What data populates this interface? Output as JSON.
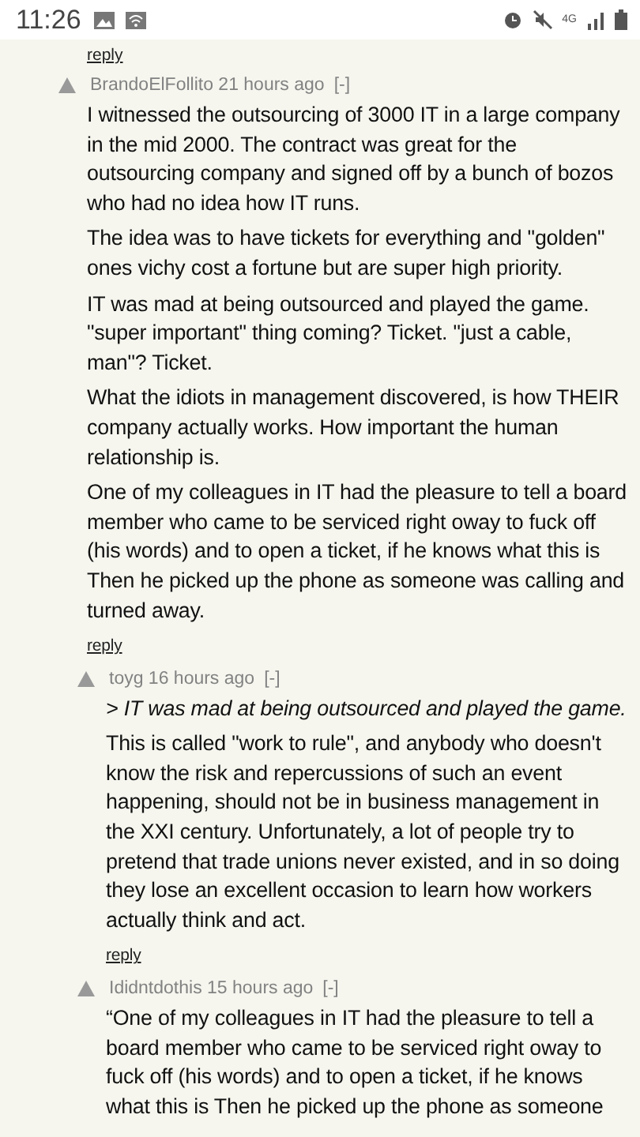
{
  "status_bar": {
    "time": "11:26",
    "network": "4G"
  },
  "top_reply": "reply",
  "comments": [
    {
      "author": "BrandoElFollito",
      "age": "21 hours ago",
      "toggle": "[-]",
      "reply": "reply",
      "paragraphs": [
        {
          "kind": "text",
          "text": "I witnessed the outsourcing of 3000 IT in a large company in the mid 2000. The contract was great for the outsourcing company and signed off by a bunch of bozos who had no idea how IT runs."
        },
        {
          "kind": "text",
          "text": "The idea was to have tickets for everything and \"golden\" ones vichy cost a fortune but are super high priority."
        },
        {
          "kind": "text",
          "text": "IT was mad at being outsourced and played the game. \"super important\" thing coming? Ticket. \"just a cable, man\"? Ticket."
        },
        {
          "kind": "text",
          "text": "What the idiots in management discovered, is how THEIR company actually works. How important the human relationship is."
        },
        {
          "kind": "text",
          "text": "One of my colleagues in IT had the pleasure to tell a board member who came to be serviced right oway to fuck off (his words) and to open a ticket, if he knows what this is Then he picked up the phone as someone was calling and turned away."
        }
      ],
      "children": [
        {
          "author": "toyg",
          "age": "16 hours ago",
          "toggle": "[-]",
          "reply": "reply",
          "paragraphs": [
            {
              "kind": "quote",
              "text": "> IT was mad at being outsourced and played the game."
            },
            {
              "kind": "text",
              "text": "This is called \"work to rule\", and anybody who doesn't know the risk and repercussions of such an event happening, should not be in business management in the XXI century. Unfortunately, a lot of people try to pretend that trade unions never existed, and in so doing they lose an excellent occasion to learn how workers actually think and act."
            }
          ]
        },
        {
          "author": "Ididntdothis",
          "age": "15 hours ago",
          "toggle": "[-]",
          "paragraphs": [
            {
              "kind": "text",
              "text": "“One of my colleagues in IT had the pleasure to tell a board member who came to be serviced right oway to fuck off (his words) and to open a ticket, if he knows what this is Then he picked up the phone as someone"
            }
          ]
        }
      ]
    }
  ]
}
